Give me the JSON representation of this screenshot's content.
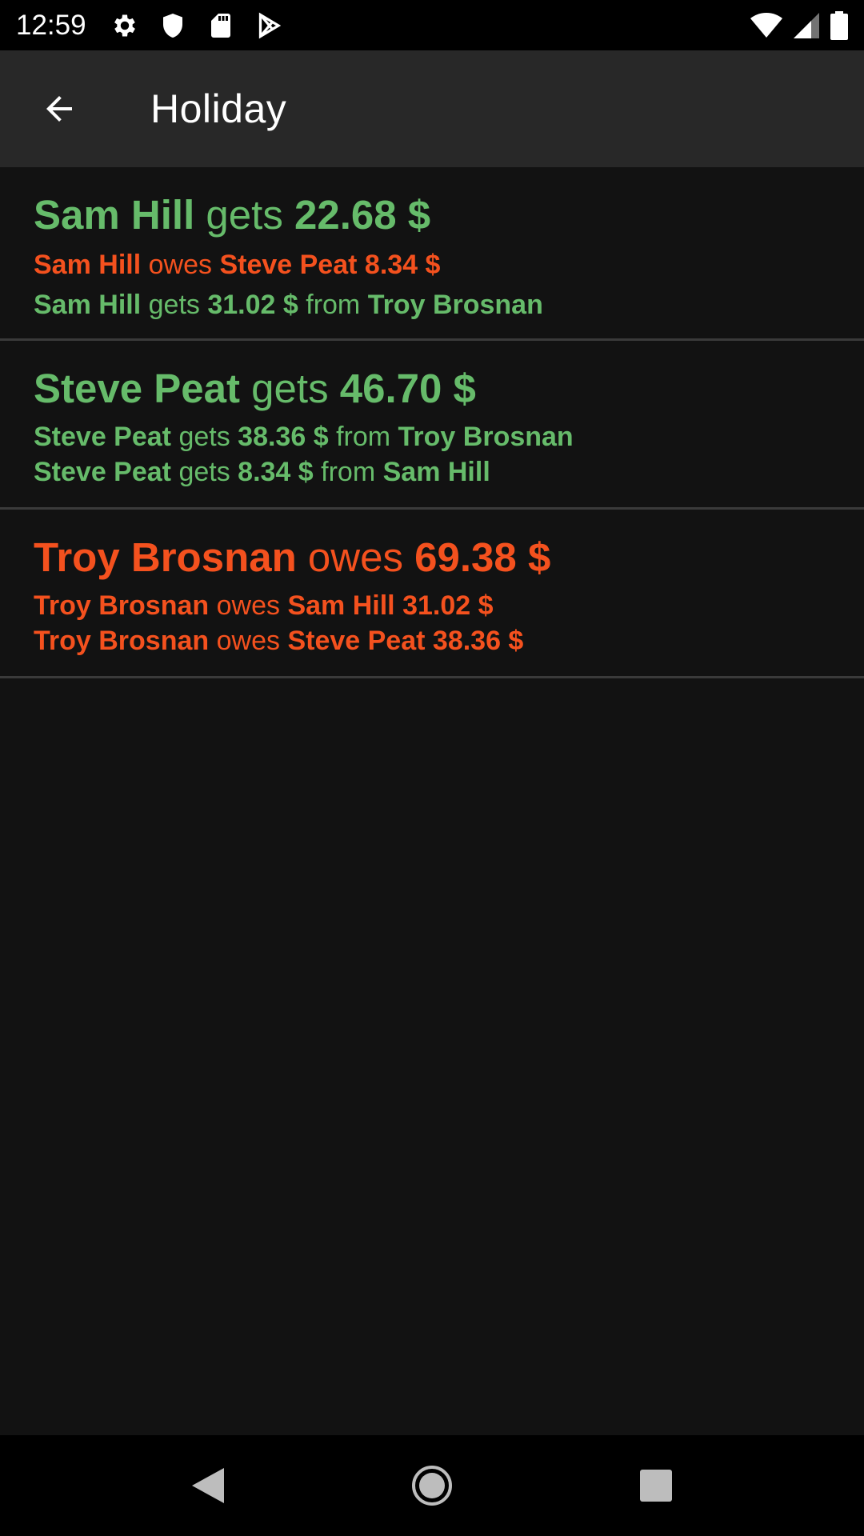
{
  "status_bar": {
    "time": "12:59",
    "icons": [
      "gear-icon",
      "shield-icon",
      "sd-card-icon",
      "play-store-icon",
      "wifi-icon",
      "signal-icon",
      "battery-icon"
    ]
  },
  "app_bar": {
    "title": "Holiday",
    "back_icon": "arrow-left-icon"
  },
  "colors": {
    "gets": "#66bb6a",
    "owes": "#f4511e",
    "background": "#121212",
    "app_bar": "#282828"
  },
  "balances": [
    {
      "person": "Sam Hill",
      "verb": "gets",
      "amount": "22.68 $",
      "status": "gets",
      "details": [
        {
          "person": "Sam Hill",
          "verb": "owes",
          "amount": "8.34 $",
          "counterparty": "Steve Peat",
          "status": "owes"
        },
        {
          "person": "Sam Hill",
          "verb": "gets",
          "amount": "31.02 $",
          "from": "from",
          "counterparty": "Troy Brosnan",
          "status": "gets"
        }
      ]
    },
    {
      "person": "Steve Peat",
      "verb": "gets",
      "amount": "46.70 $",
      "status": "gets",
      "details": [
        {
          "person": "Steve Peat",
          "verb": "gets",
          "amount": "38.36 $",
          "from": "from",
          "counterparty": "Troy Brosnan",
          "status": "gets"
        },
        {
          "person": "Steve Peat",
          "verb": "gets",
          "amount": "8.34 $",
          "from": "from",
          "counterparty": "Sam Hill",
          "status": "gets"
        }
      ]
    },
    {
      "person": "Troy Brosnan",
      "verb": "owes",
      "amount": "69.38 $",
      "status": "owes",
      "details": [
        {
          "person": "Troy Brosnan",
          "verb": "owes",
          "amount": "31.02 $",
          "counterparty": "Sam Hill",
          "status": "owes"
        },
        {
          "person": "Troy Brosnan",
          "verb": "owes",
          "amount": "38.36 $",
          "counterparty": "Steve Peat",
          "status": "owes"
        }
      ]
    }
  ],
  "nav_bar": {
    "icons": [
      "back-triangle-icon",
      "home-circle-icon",
      "recents-square-icon"
    ]
  }
}
